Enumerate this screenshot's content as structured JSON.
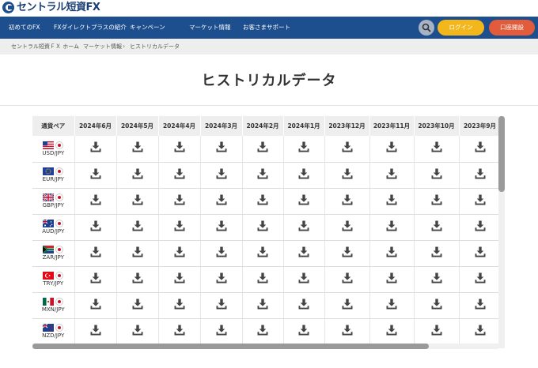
{
  "brand": {
    "logo_text": "セントラル短資FX"
  },
  "nav": {
    "items": [
      "初めてのFX",
      "FXダイレクトプラスの紹介",
      "キャンペーン",
      "マーケット情報",
      "お客さまサポート"
    ],
    "login_label": "ログイン",
    "open_account_label": "口座開設"
  },
  "breadcrumb": [
    "セントラル短資ＦＸ ホーム",
    "マーケット情報",
    "ヒストリカルデータ"
  ],
  "page_title": "ヒストリカルデータ",
  "table": {
    "pair_header": "通貨ペア",
    "months": [
      "2024年6月",
      "2024年5月",
      "2024年4月",
      "2024年3月",
      "2024年2月",
      "2024年1月",
      "2023年12月",
      "2023年11月",
      "2023年10月",
      "2023年9月"
    ],
    "pairs": [
      {
        "label": "USD/JPY",
        "flag": "us-flag"
      },
      {
        "label": "EUR/JPY",
        "flag": "eu-flag"
      },
      {
        "label": "GBP/JPY",
        "flag": "gb-flag"
      },
      {
        "label": "AUD/JPY",
        "flag": "au-flag"
      },
      {
        "label": "ZAR/JPY",
        "flag": "za-flag"
      },
      {
        "label": "TRY/JPY",
        "flag": "tr-flag"
      },
      {
        "label": "MXN/JPY",
        "flag": "mx-flag"
      },
      {
        "label": "NZD/JPY",
        "flag": "nz-flag"
      }
    ],
    "cell_icon": "download-icon"
  },
  "colors": {
    "nav_bg": "#1d4f8f",
    "login_bg": "#f3b71c",
    "open_account_bg": "#e25b3b",
    "header_bg": "#eeeeee",
    "icon": "#444444"
  }
}
